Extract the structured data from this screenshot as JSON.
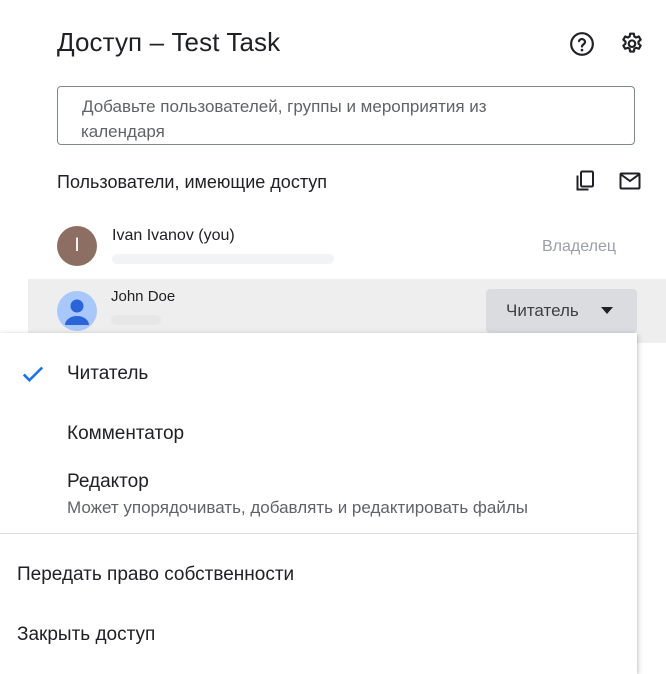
{
  "dialog": {
    "title": "Доступ – Test Task",
    "help_icon": "help-circle-icon",
    "settings_icon": "gear-icon"
  },
  "add_people": {
    "placeholder_line1": "Добавьте пользователей, группы и мероприятия из",
    "placeholder_line2": "календаря"
  },
  "people_section": {
    "title": "Пользователи, имеющие доступ",
    "copy_icon": "copy-icon",
    "email_icon": "mail-icon",
    "users": [
      {
        "name": "Ivan Ivanov (you)",
        "avatar_letter": "I",
        "avatar_color": "#8d6e63",
        "role": "Владелец"
      },
      {
        "name": "John Doe",
        "avatar_color": "#a8c7fa",
        "role": "Читатель"
      }
    ]
  },
  "role_menu": {
    "selected": "Читатель",
    "items": [
      {
        "label": "Читатель",
        "checked": true
      },
      {
        "label": "Комментатор",
        "checked": false
      },
      {
        "label": "Редактор",
        "checked": false,
        "description": "Может упорядочивать, добавлять и редактировать файлы"
      }
    ],
    "actions": [
      {
        "label": "Передать право собственности"
      },
      {
        "label": "Закрыть доступ"
      }
    ],
    "accent_color": "#1a73e8"
  }
}
